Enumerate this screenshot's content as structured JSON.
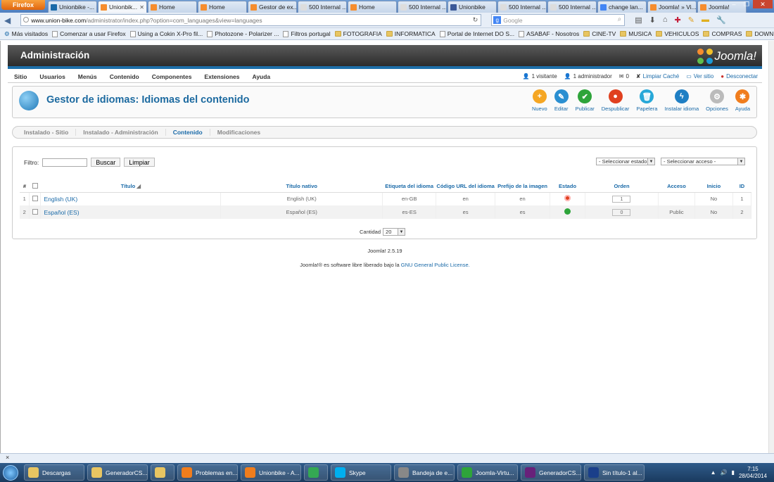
{
  "browser": {
    "firefox_label": "Firefox",
    "tabs": [
      {
        "label": "Unionbike -...",
        "color": "#1a6aa8",
        "active": false
      },
      {
        "label": "Unionbik...",
        "color": "#f68d2e",
        "active": true
      },
      {
        "label": "Home",
        "color": "#f68d2e",
        "active": false
      },
      {
        "label": "Home",
        "color": "#f68d2e",
        "active": false
      },
      {
        "label": "Gestor de ex...",
        "color": "#f68d2e",
        "active": false
      },
      {
        "label": "500 Internal ...",
        "color": "#ddd",
        "active": false
      },
      {
        "label": "Home",
        "color": "#f68d2e",
        "active": false
      },
      {
        "label": "500 Internal ...",
        "color": "#ddd",
        "active": false
      },
      {
        "label": "Unionbike",
        "color": "#3b5998",
        "active": false
      },
      {
        "label": "500 Internal ...",
        "color": "#ddd",
        "active": false
      },
      {
        "label": "500 Internal ...",
        "color": "#ddd",
        "active": false
      },
      {
        "label": "change lan...",
        "color": "#4285f4",
        "active": false
      },
      {
        "label": "Joomla! » Vi...",
        "color": "#f68d2e",
        "active": false
      },
      {
        "label": "Joomla!",
        "color": "#f68d2e",
        "active": false
      }
    ],
    "url_domain": "www.union-bike.com",
    "url_path": "/administrator/index.php?option=com_languages&view=languages",
    "search_placeholder": "Google",
    "bookmarks": [
      {
        "label": "Más visitados",
        "kind": "special"
      },
      {
        "label": "Comenzar a usar Firefox",
        "kind": "page"
      },
      {
        "label": "Using a Cokin X-Pro fil...",
        "kind": "page"
      },
      {
        "label": "Photozone - Polarizer ...",
        "kind": "page"
      },
      {
        "label": "Filtros portugal",
        "kind": "page"
      },
      {
        "label": "FOTOGRAFIA",
        "kind": "folder"
      },
      {
        "label": "INFORMATICA",
        "kind": "folder"
      },
      {
        "label": "Portal de Internet DO S...",
        "kind": "page"
      },
      {
        "label": "ASABAF - Nosotros",
        "kind": "page"
      },
      {
        "label": "CINE-TV",
        "kind": "folder"
      },
      {
        "label": "MUSICA",
        "kind": "folder"
      },
      {
        "label": "VEHICULOS",
        "kind": "folder"
      },
      {
        "label": "COMPRAS",
        "kind": "folder"
      },
      {
        "label": "DOWNLOAD",
        "kind": "folder"
      }
    ],
    "statusbar_close": "×"
  },
  "admin": {
    "header_title": "Administración",
    "logo_text": "Joomla!",
    "menu": [
      "Sitio",
      "Usuarios",
      "Menús",
      "Contenido",
      "Componentes",
      "Extensiones",
      "Ayuda"
    ],
    "status": {
      "visitors": "1 visitante",
      "admins": "1 administrador",
      "messages": "0",
      "clear_cache": "Limpiar Caché",
      "view_site": "Ver sitio",
      "logout": "Desconectar"
    },
    "page_title": "Gestor de idiomas: Idiomas del contenido",
    "toolbar": [
      {
        "label": "Nuevo",
        "color": "#f5a623",
        "glyph": "+"
      },
      {
        "label": "Editar",
        "color": "#2a8fd1",
        "glyph": "✎"
      },
      {
        "label": "Publicar",
        "color": "#2ea43a",
        "glyph": "✔"
      },
      {
        "label": "Despublicar",
        "color": "#e0401f",
        "glyph": "●"
      },
      {
        "label": "Papelera",
        "color": "#27a8d8",
        "glyph": "🗑"
      },
      {
        "label": "Instalar idioma",
        "color": "#1f7fc4",
        "glyph": "ϟ"
      },
      {
        "label": "Opciones",
        "color": "#bbbbbb",
        "glyph": "⚙"
      },
      {
        "label": "Ayuda",
        "color": "#f07d1d",
        "glyph": "✱"
      }
    ],
    "subtabs": [
      {
        "label": "Instalado - Sitio",
        "active": false
      },
      {
        "label": "Instalado - Administración",
        "active": false
      },
      {
        "label": "Contenido",
        "active": true
      },
      {
        "label": "Modificaciones",
        "active": false
      }
    ],
    "filter": {
      "label": "Filtro:",
      "value": "",
      "search_button": "Buscar",
      "clear_button": "Limpiar",
      "state_select": "- Seleccionar estado -",
      "access_select": "- Seleccionar acceso -"
    },
    "table": {
      "headers": [
        "#",
        "",
        "Título",
        "Título nativo",
        "Etiqueta del idioma",
        "Código URL del idioma",
        "Prefijo de la imagen",
        "Estado",
        "Orden",
        "Acceso",
        "Inicio",
        "ID"
      ],
      "rows": [
        {
          "num": "1",
          "title": "English (UK)",
          "native": "English (UK)",
          "tag": "en-GB",
          "sef": "en",
          "image": "en",
          "state": "unpublished",
          "order": "1",
          "access": "",
          "home": "No",
          "id": "1"
        },
        {
          "num": "2",
          "title": "Español (ES)",
          "native": "Español (ES)",
          "tag": "es-ES",
          "sef": "es",
          "image": "es",
          "state": "published",
          "order": "0",
          "access": "Public",
          "home": "No",
          "id": "2"
        }
      ],
      "limit_label": "Cantidad",
      "limit_value": "20"
    },
    "footer_version": "Joomla! 2.5.19",
    "footer_license_prefix": "Joomla!® es software libre liberado bajo la ",
    "footer_license_link": "GNU General Public License."
  },
  "taskbar": {
    "items": [
      {
        "label": "Descargas",
        "color": "#e8c562"
      },
      {
        "label": "GeneradorCS...",
        "color": "#e8c562"
      },
      {
        "label": "",
        "color": "#e8c562"
      },
      {
        "label": "Problemas en...",
        "color": "#f07d1d"
      },
      {
        "label": "Unionbike - A...",
        "color": "#f07d1d"
      },
      {
        "label": "",
        "color": "#34a853"
      },
      {
        "label": "Skype",
        "color": "#00aff0"
      },
      {
        "label": "Bandeja de e...",
        "color": "#888888"
      },
      {
        "label": "Joomla-Virtu...",
        "color": "#2ea43a"
      },
      {
        "label": "GeneradorCS...",
        "color": "#68217a"
      },
      {
        "label": "Sin título-1 al...",
        "color": "#1a3f8a"
      }
    ],
    "time": "7:15",
    "date": "28/04/2014"
  }
}
